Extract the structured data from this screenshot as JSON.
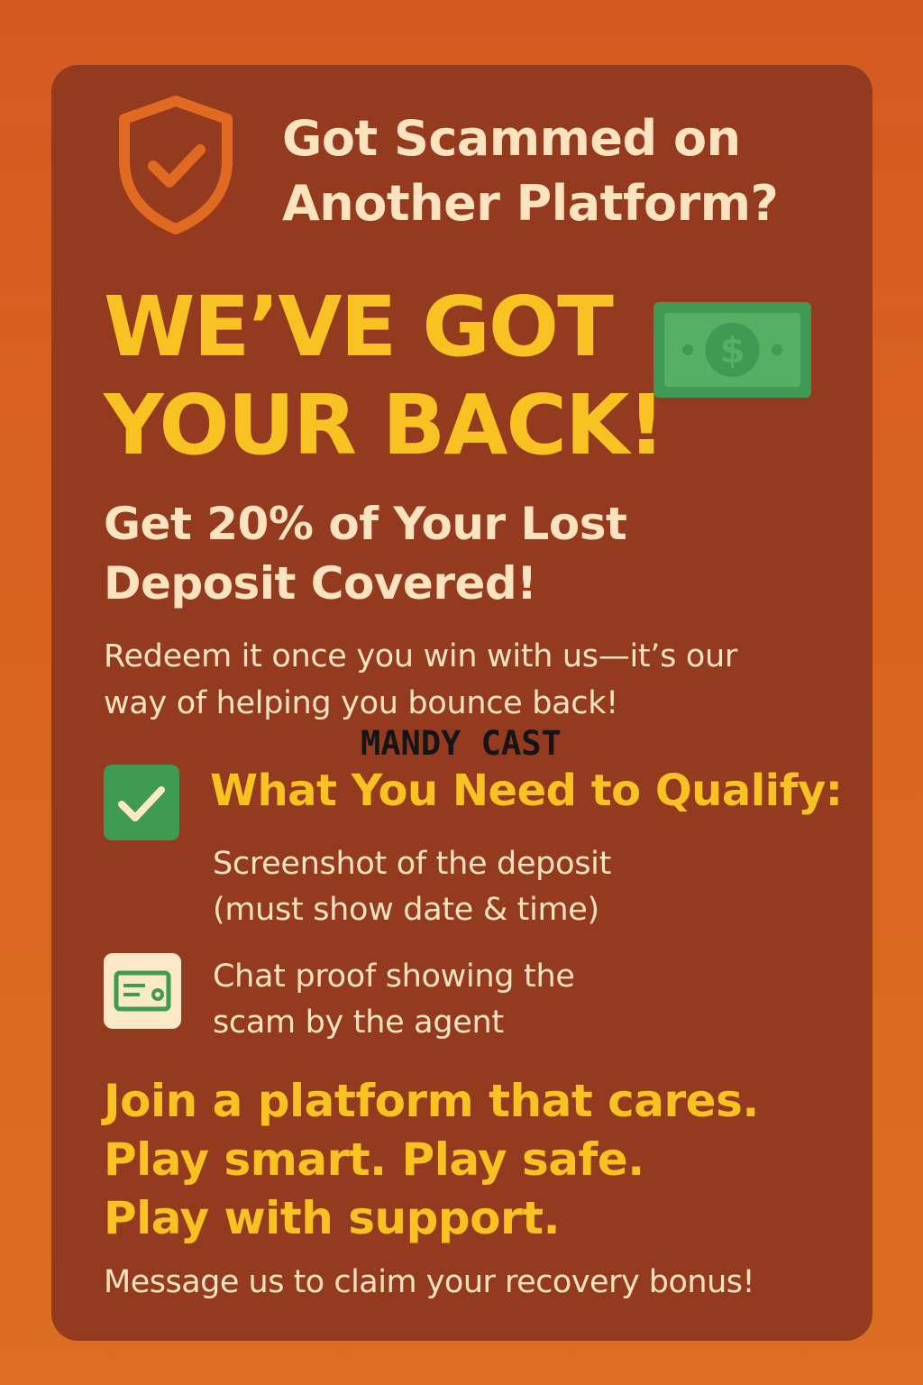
{
  "colors": {
    "background": "#d9651f",
    "card": "#933a1f",
    "accent_yellow": "#f8c222",
    "cream_text": "#fbe3c0",
    "shield_orange": "#e06a22",
    "green": "#3f9a53"
  },
  "header": {
    "icon": "shield-check-icon",
    "title_line1": "Got Scammed on",
    "title_line2": "Another Platform?"
  },
  "hero": {
    "line1": "WE’VE GOT",
    "line2": "YOUR BACK!",
    "icon": "money-bill-icon"
  },
  "offer": {
    "line1": "Get 20% of Your Lost",
    "line2": "Deposit Covered!"
  },
  "subtext": {
    "line1": "Redeem it once you win with us—it’s our",
    "line2": "way of helping you bounce back!"
  },
  "stamp": "MANDY CAST",
  "requirements": {
    "heading": "What You Need to Qualify:",
    "heading_icon": "checkmark-icon",
    "items": [
      {
        "line1": "Screenshot of the deposit",
        "line2": "(must show date & time)"
      },
      {
        "line1": "Chat proof showing the",
        "line2": "scam by the agent",
        "icon": "payment-card-icon"
      }
    ]
  },
  "tagline": {
    "line1": "Join a platform that cares.",
    "line2": "Play smart. Play safe.",
    "line3": "Play with support."
  },
  "cta": "Message us to claim your recovery bonus!"
}
